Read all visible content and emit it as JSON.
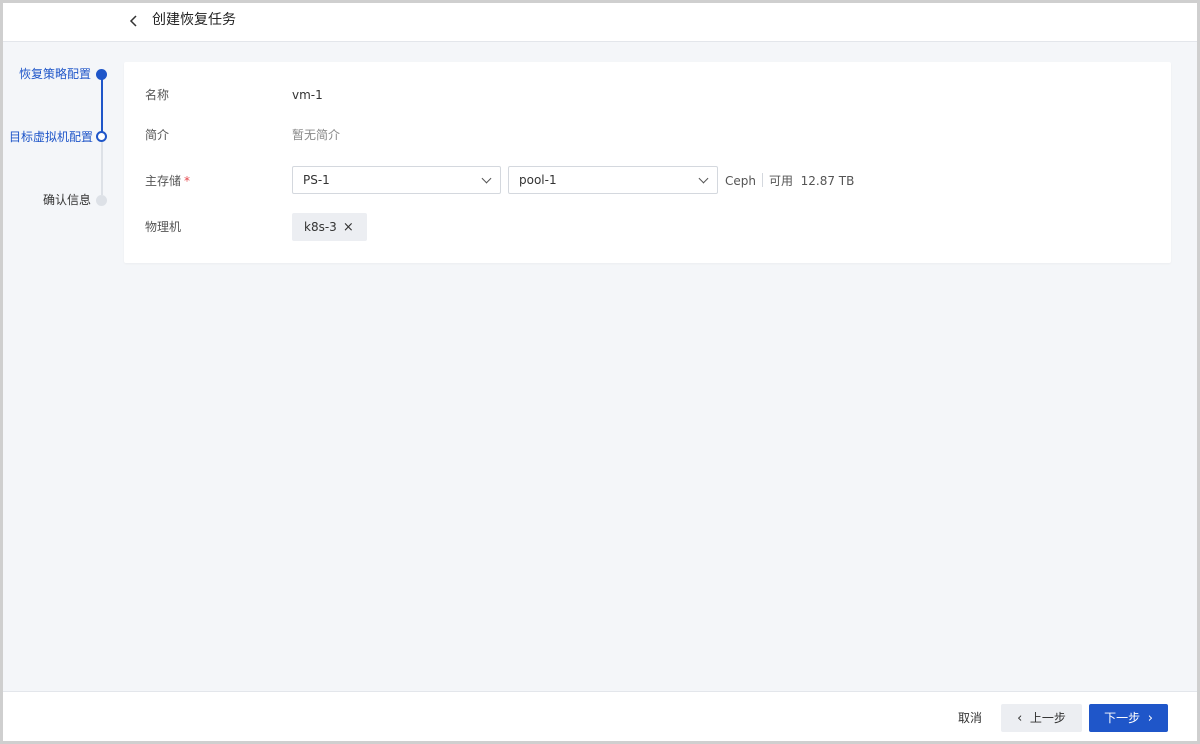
{
  "header": {
    "back_icon": "chevron-left-icon",
    "title": "创建恢复任务"
  },
  "steps": [
    {
      "label": "恢复策略配置",
      "state": "active"
    },
    {
      "label": "目标虚拟机配置",
      "state": "current"
    },
    {
      "label": "确认信息",
      "state": "pending"
    }
  ],
  "form": {
    "name_label": "名称",
    "name_value": "vm-1",
    "desc_label": "简介",
    "desc_value": "暂无简介",
    "storage_label": "主存储",
    "storage_required_mark": "*",
    "storage_select": "PS-1",
    "pool_select": "pool-1",
    "storage_type": "Ceph",
    "available_label": "可用",
    "available_value": "12.87 TB",
    "host_label": "物理机",
    "host_tag": "k8s-3",
    "host_tag_remove": "×"
  },
  "footer": {
    "cancel": "取消",
    "prev": "上一步",
    "prev_arrow": "‹",
    "next": "下一步",
    "next_arrow": "›"
  },
  "colors": {
    "accent": "#1f56c9",
    "required": "#e5484d",
    "background": "#f4f6f9"
  }
}
